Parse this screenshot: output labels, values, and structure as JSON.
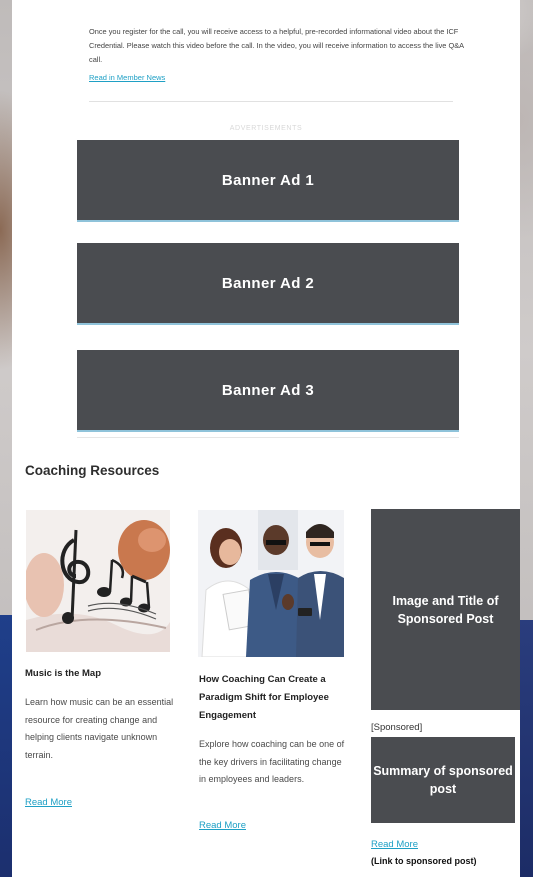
{
  "intro": {
    "text": "Once you register for the call, you will receive access to a helpful, pre-recorded informational video about the ICF Credential. Please watch this video before the call. In the video, you will receive information to access the live Q&A call.",
    "link": "Read in Member News"
  },
  "ads": {
    "label": "ADVERTISEMENTS",
    "banners": [
      "Banner Ad 1",
      "Banner Ad 2",
      "Banner Ad 3"
    ]
  },
  "resources": {
    "title": "Coaching Resources",
    "cards": [
      {
        "title": "Music is the Map",
        "description": "Learn how music can be an essential resource for creating change and helping clients navigate unknown terrain.",
        "link": "Read More"
      },
      {
        "title": "How Coaching Can Create a Paradigm Shift for Employee Engagement",
        "description": "Explore how coaching can be one of the key drivers in facilitating change in employees and leaders.",
        "link": "Read More"
      }
    ],
    "sponsored": {
      "image_title": "Image and Title of Sponsored Post",
      "tag": "[Sponsored]",
      "summary": "Summary of sponsored post",
      "link": "Read More",
      "link_note": "(Link to sponsored post)"
    }
  },
  "colors": {
    "banner": "#4a4c50",
    "link": "#1fa0c5"
  }
}
